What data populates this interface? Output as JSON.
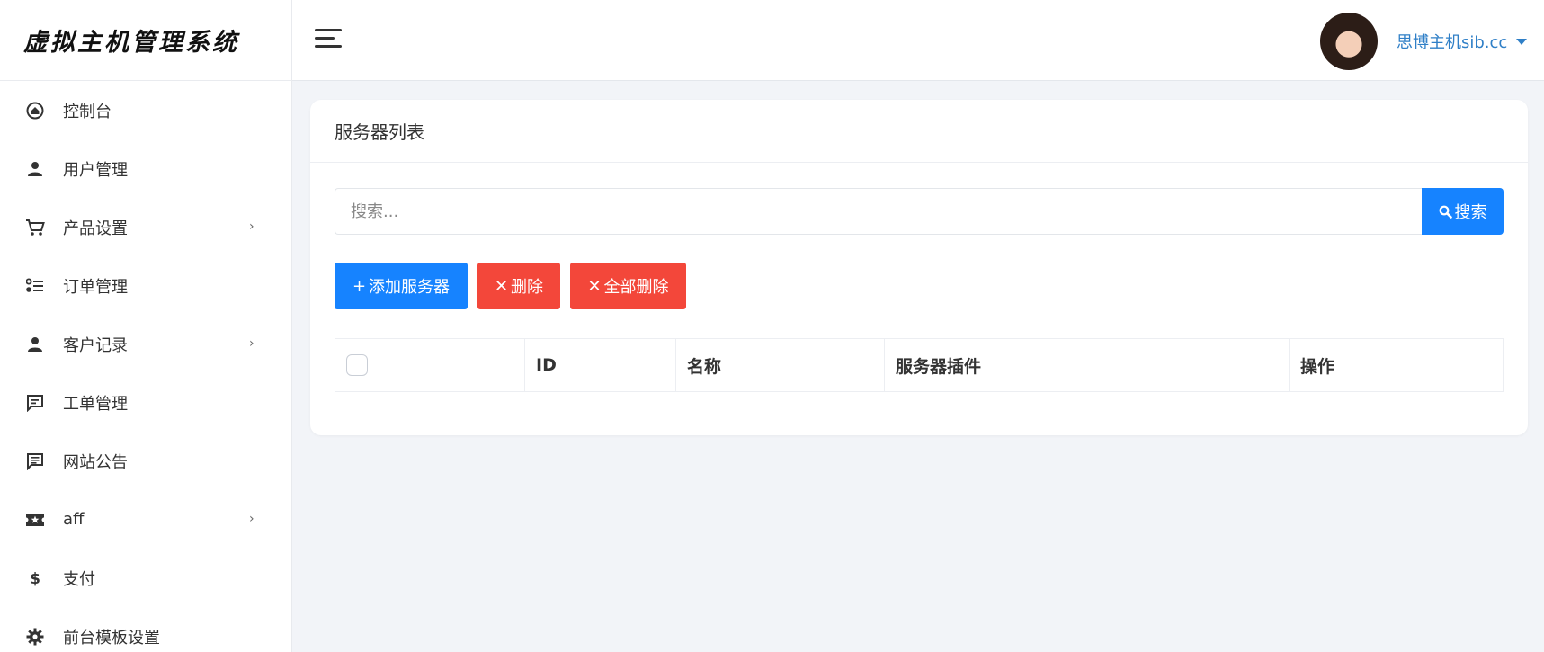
{
  "brand": {
    "title": "虚拟主机管理系统"
  },
  "sidebar": {
    "items": [
      {
        "label": "控制台",
        "icon": "home-icon",
        "has_submenu": false
      },
      {
        "label": "用户管理",
        "icon": "user-icon",
        "has_submenu": false
      },
      {
        "label": "产品设置",
        "icon": "cart-icon",
        "has_submenu": true
      },
      {
        "label": "订单管理",
        "icon": "list-icon",
        "has_submenu": false
      },
      {
        "label": "客户记录",
        "icon": "user-icon",
        "has_submenu": true
      },
      {
        "label": "工单管理",
        "icon": "message-icon",
        "has_submenu": false
      },
      {
        "label": "网站公告",
        "icon": "announcement-icon",
        "has_submenu": false
      },
      {
        "label": "aff",
        "icon": "ticket-icon",
        "has_submenu": true
      },
      {
        "label": "支付",
        "icon": "dollar-icon",
        "has_submenu": false
      },
      {
        "label": "前台模板设置",
        "icon": "gear-icon",
        "has_submenu": false
      }
    ],
    "chevron": "›"
  },
  "header": {
    "user_name": "思博主机sib.cc"
  },
  "main": {
    "card_title": "服务器列表",
    "search": {
      "placeholder": "搜索...",
      "button_label": "搜索"
    },
    "actions": {
      "add_label": "添加服务器",
      "delete_label": "删除",
      "delete_all_label": "全部删除"
    },
    "table": {
      "columns": [
        "ID",
        "名称",
        "服务器插件",
        "操作"
      ],
      "rows": []
    }
  },
  "colors": {
    "primary": "#1683ff",
    "danger": "#f3473a",
    "link": "#2f7fc7",
    "background": "#f2f4f8"
  }
}
